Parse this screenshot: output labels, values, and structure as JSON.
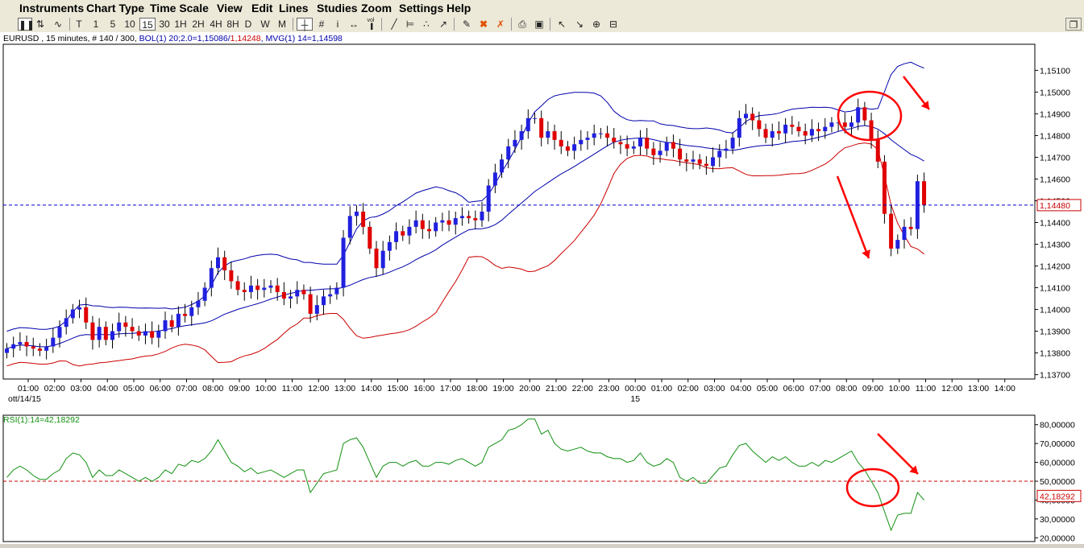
{
  "menu": [
    {
      "id": "instruments",
      "label": "Instruments"
    },
    {
      "id": "chart-type",
      "label": "Chart Type"
    },
    {
      "id": "time-scale",
      "label": "Time Scale"
    },
    {
      "id": "view",
      "label": "View"
    },
    {
      "id": "edit",
      "label": "Edit"
    },
    {
      "id": "lines",
      "label": "Lines"
    },
    {
      "id": "studies",
      "label": "Studies"
    },
    {
      "id": "zoom",
      "label": "Zoom"
    },
    {
      "id": "settings",
      "label": "Settings"
    },
    {
      "id": "help",
      "label": "Help"
    }
  ],
  "toolbar": {
    "timeframes": [
      "T",
      "1",
      "5",
      "10",
      "15",
      "30",
      "1H",
      "2H",
      "4H",
      "8H",
      "D",
      "W",
      "M"
    ],
    "selected_timeframe": "15",
    "icons": [
      "candle-chart-icon",
      "bar-chart-icon",
      "line-chart-icon",
      "crosshair-icon",
      "grid-icon",
      "info-icon",
      "scroll-icon",
      "volume-icon",
      "draw-line-icon",
      "draw-hline-icon",
      "draw-vline-icon",
      "draw-trend-icon",
      "pencil-icon",
      "delete-drawing-icon",
      "delete-all-icon",
      "print-icon",
      "print-preview-icon",
      "zoom-in-icon",
      "zoom-out-icon",
      "zoom-fit-icon",
      "zoom-reset-icon",
      "window-restore-icon"
    ]
  },
  "chart_header": {
    "instrument": "EURUSD , 15 minutes, # 140 / 300,",
    "bol_label": "BOL(1) 20;2.0=1,15086/",
    "bol_lower": "1,14248",
    "mvg_label": ", MVG(1) 14=1,14598"
  },
  "rsi_header": "RSI(1):14=42,18292",
  "colors": {
    "bull": "#2020e0",
    "bear": "#e00000",
    "upper_band": "#0000aa",
    "lower_band": "#cc0000",
    "mvg": "#0000aa",
    "rsi": "#109010",
    "annotation": "#ff0000",
    "price_line": "#0000cc",
    "rsi_level": "#cc0000"
  },
  "chart_data": [
    {
      "type": "candlestick",
      "instrument": "EURUSD",
      "timeframe": "15 minutes",
      "date_label": "ott/14/15",
      "next_day_label": "15",
      "x_ticks": [
        "01:00",
        "02:00",
        "03:00",
        "04:00",
        "05:00",
        "06:00",
        "07:00",
        "08:00",
        "09:00",
        "10:00",
        "11:00",
        "12:00",
        "13:00",
        "14:00",
        "15:00",
        "16:00",
        "17:00",
        "18:00",
        "19:00",
        "20:00",
        "21:00",
        "22:00",
        "23:00",
        "00:00",
        "01:00",
        "02:00",
        "03:00",
        "04:00",
        "05:00",
        "06:00",
        "07:00",
        "08:00",
        "09:00",
        "10:00",
        "11:00",
        "12:00",
        "13:00",
        "14:00"
      ],
      "y_ticks": [
        "1,15100",
        "1,15000",
        "1,14900",
        "1,14800",
        "1,14700",
        "1,14600",
        "1,14500",
        "1,14400",
        "1,14300",
        "1,14200",
        "1,14100",
        "1,14000",
        "1,13900",
        "1,13800",
        "1,13700"
      ],
      "y_range": [
        1.1368,
        1.1522
      ],
      "current_price": 1.1448,
      "current_price_label": "1,14480",
      "closes": [
        1.1382,
        1.1384,
        1.1385,
        1.1383,
        1.1382,
        1.1381,
        1.1383,
        1.1387,
        1.1392,
        1.1396,
        1.14,
        1.1401,
        1.1394,
        1.1386,
        1.1392,
        1.1386,
        1.139,
        1.1394,
        1.1392,
        1.139,
        1.1388,
        1.139,
        1.1387,
        1.139,
        1.1395,
        1.1392,
        1.1398,
        1.1397,
        1.1401,
        1.1404,
        1.141,
        1.1419,
        1.1424,
        1.1418,
        1.1413,
        1.1409,
        1.1408,
        1.1411,
        1.1409,
        1.141,
        1.1411,
        1.1408,
        1.1405,
        1.1406,
        1.1409,
        1.1407,
        1.1398,
        1.1402,
        1.1406,
        1.1407,
        1.141,
        1.1433,
        1.1443,
        1.1445,
        1.1438,
        1.1428,
        1.1419,
        1.1427,
        1.1431,
        1.1436,
        1.1434,
        1.1438,
        1.1441,
        1.1437,
        1.1436,
        1.144,
        1.1441,
        1.1439,
        1.1442,
        1.1443,
        1.1442,
        1.1441,
        1.1445,
        1.1457,
        1.1463,
        1.1469,
        1.1475,
        1.1478,
        1.1482,
        1.1488,
        1.1488,
        1.1479,
        1.1482,
        1.1478,
        1.1475,
        1.1473,
        1.1476,
        1.1478,
        1.1479,
        1.1481,
        1.1481,
        1.1479,
        1.1477,
        1.1476,
        1.1474,
        1.1475,
        1.1479,
        1.1474,
        1.1471,
        1.1473,
        1.1477,
        1.1474,
        1.1469,
        1.1468,
        1.1469,
        1.1467,
        1.1466,
        1.147,
        1.1473,
        1.1474,
        1.1479,
        1.1488,
        1.149,
        1.1487,
        1.1483,
        1.1479,
        1.1482,
        1.1481,
        1.1485,
        1.1484,
        1.1482,
        1.148,
        1.1483,
        1.1482,
        1.1484,
        1.1486,
        1.1486,
        1.1484,
        1.1486,
        1.1493,
        1.1487,
        1.1478,
        1.1468,
        1.1444,
        1.1428,
        1.1432,
        1.1438,
        1.1437,
        1.1459,
        1.1448
      ],
      "rsi": {
        "type": "line",
        "period": 14,
        "current": 42.18292,
        "current_label": "42,18292",
        "y_ticks": [
          "80,00000",
          "70,00000",
          "60,00000",
          "50,00000",
          "40,00000",
          "30,00000",
          "20,00000"
        ],
        "y_range": [
          18,
          85
        ],
        "level": 50,
        "values": [
          52,
          56,
          58,
          56,
          53,
          51,
          51,
          54,
          56,
          62,
          65,
          64,
          60,
          52,
          56,
          53,
          53,
          56,
          54,
          52,
          50,
          52,
          50,
          52,
          56,
          54,
          59,
          58,
          61,
          60,
          62,
          66,
          72,
          66,
          60,
          58,
          55,
          57,
          54,
          55,
          56,
          54,
          52,
          54,
          56,
          56,
          44,
          49,
          54,
          55,
          56,
          70,
          72,
          73,
          68,
          60,
          52,
          58,
          60,
          60,
          58,
          60,
          61,
          58,
          58,
          60,
          60,
          59,
          61,
          62,
          60,
          58,
          60,
          68,
          70,
          72,
          77,
          78,
          80,
          83,
          83,
          75,
          77,
          70,
          67,
          66,
          67,
          68,
          66,
          65,
          65,
          63,
          62,
          62,
          60,
          61,
          65,
          60,
          58,
          59,
          62,
          60,
          52,
          50,
          52,
          49,
          49,
          53,
          57,
          58,
          64,
          69,
          70,
          66,
          63,
          60,
          63,
          61,
          63,
          60,
          58,
          58,
          60,
          58,
          61,
          60,
          62,
          64,
          66,
          60,
          56,
          50,
          44,
          34,
          24,
          32,
          33,
          33,
          44,
          40
        ]
      }
    }
  ],
  "annotations": [
    "red-circle",
    "red-arrow-down"
  ]
}
